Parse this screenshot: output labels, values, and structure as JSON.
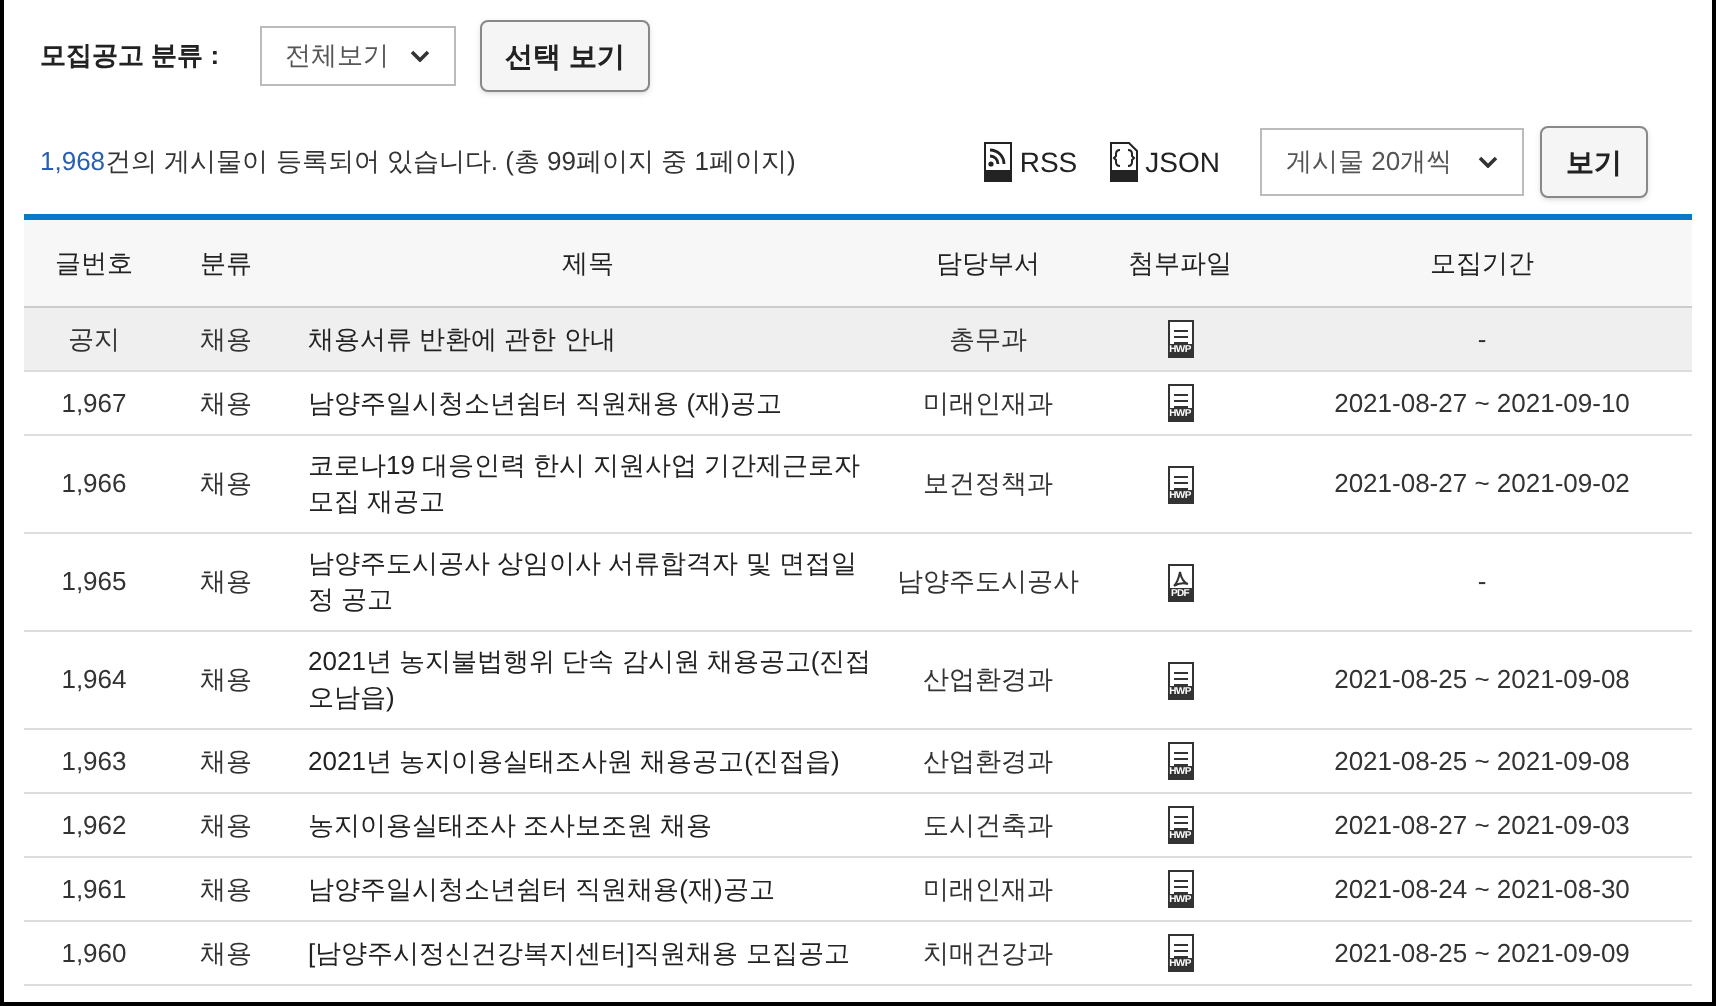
{
  "filter": {
    "label": "모집공고 분류 :",
    "select": "전체보기",
    "button": "선택 보기"
  },
  "summary": {
    "count": "1,968",
    "text": "건의 게시물이 등록되어 있습니다. (총 99페이지 중 1페이지)"
  },
  "feeds": [
    {
      "kind": "rss",
      "label": "RSS"
    },
    {
      "kind": "json",
      "label": "JSON"
    }
  ],
  "page_size": {
    "select": "게시물 20개씩",
    "button": "보기"
  },
  "table": {
    "columns": [
      "글번호",
      "분류",
      "제목",
      "담당부서",
      "첨부파일",
      "모집기간"
    ],
    "rows": [
      {
        "notice": true,
        "number": "공지",
        "category": "채용",
        "title": "채용서류 반환에 관한 안내",
        "department": "총무과",
        "file": {
          "kind": "hwp",
          "label": "HWP"
        },
        "period": "-"
      },
      {
        "notice": false,
        "number": "1,967",
        "category": "채용",
        "title": "남양주일시청소년쉼터 직원채용 (재)공고",
        "department": "미래인재과",
        "file": {
          "kind": "hwp",
          "label": "HWP"
        },
        "period": "2021-08-27 ~ 2021-09-10"
      },
      {
        "notice": false,
        "number": "1,966",
        "category": "채용",
        "title": "코로나19 대응인력 한시 지원사업 기간제근로자 모집 재공고",
        "department": "보건정책과",
        "file": {
          "kind": "hwp",
          "label": "HWP"
        },
        "period": "2021-08-27 ~ 2021-09-02"
      },
      {
        "notice": false,
        "number": "1,965",
        "category": "채용",
        "title": "남양주도시공사 상임이사 서류합격자 및 면접일정 공고",
        "department": "남양주도시공사",
        "file": {
          "kind": "pdf",
          "label": "PDF"
        },
        "period": "-"
      },
      {
        "notice": false,
        "number": "1,964",
        "category": "채용",
        "title": "2021년 농지불법행위 단속 감시원 채용공고(진접오남읍)",
        "department": "산업환경과",
        "file": {
          "kind": "hwp",
          "label": "HWP"
        },
        "period": "2021-08-25 ~ 2021-09-08"
      },
      {
        "notice": false,
        "number": "1,963",
        "category": "채용",
        "title": "2021년 농지이용실태조사원 채용공고(진접읍)",
        "department": "산업환경과",
        "file": {
          "kind": "hwp",
          "label": "HWP"
        },
        "period": "2021-08-25 ~ 2021-09-08"
      },
      {
        "notice": false,
        "number": "1,962",
        "category": "채용",
        "title": "농지이용실태조사 조사보조원 채용",
        "department": "도시건축과",
        "file": {
          "kind": "hwp",
          "label": "HWP"
        },
        "period": "2021-08-27 ~ 2021-09-03"
      },
      {
        "notice": false,
        "number": "1,961",
        "category": "채용",
        "title": "남양주일시청소년쉼터 직원채용(재)공고",
        "department": "미래인재과",
        "file": {
          "kind": "hwp",
          "label": "HWP"
        },
        "period": "2021-08-24 ~ 2021-08-30"
      },
      {
        "notice": false,
        "number": "1,960",
        "category": "채용",
        "title": "[남양주시정신건강복지센터]직원채용 모집공고",
        "department": "치매건강과",
        "file": {
          "kind": "hwp",
          "label": "HWP"
        },
        "period": "2021-08-25 ~ 2021-09-09"
      }
    ]
  }
}
